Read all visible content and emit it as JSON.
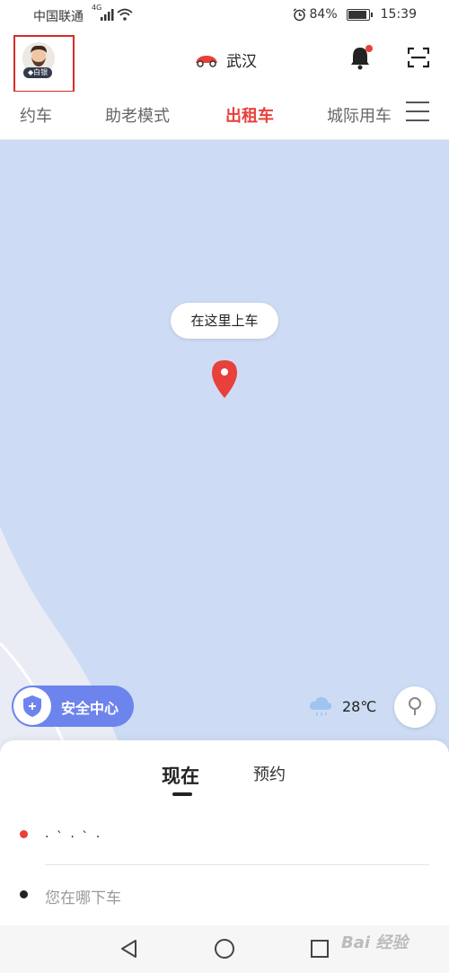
{
  "status_bar": {
    "carrier": "中国联通",
    "network": "4G",
    "battery": "84%",
    "time": "15:39",
    "battery_level": 0.84
  },
  "header": {
    "badge": "白银",
    "city": "武汉"
  },
  "tabs": [
    {
      "label": "约车"
    },
    {
      "label": "助老模式"
    },
    {
      "label": "出租车",
      "active": true
    },
    {
      "label": "城际用车"
    }
  ],
  "map": {
    "pickup_tooltip": "在这里上车",
    "safety_center": "安全中心",
    "temperature": "28℃"
  },
  "panel": {
    "modes": [
      "现在",
      "预约"
    ],
    "origin_text": "· ` · ` ·",
    "destination_placeholder": "您在哪下车"
  },
  "watermark": "Bai 经验",
  "colors": {
    "accent": "#e8403a",
    "map": "#cddcf4",
    "safety": "#6d84ec"
  }
}
